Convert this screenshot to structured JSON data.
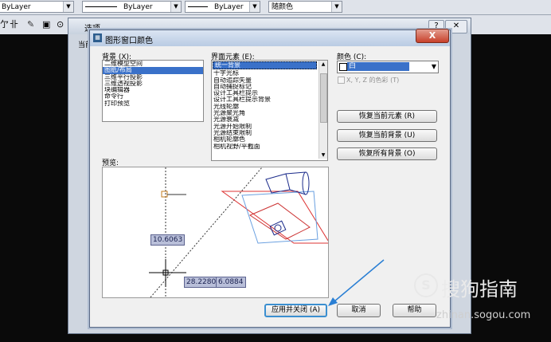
{
  "toolbar": {
    "layer_combo": "ByLayer",
    "linetype_combo": "ByLayer",
    "lineweight_combo": "ByLayer",
    "color_combo": "随颜色",
    "dialog_title": "选项",
    "current_label": "当前"
  },
  "dialog": {
    "title": "图形窗口颜色",
    "close_glyph": "X",
    "help_glyph": "?",
    "background_label": "背景 (X):",
    "background_items": [
      "二维模型空间",
      "图纸/布局",
      "三维平行投影",
      "三维透视投影",
      "块编辑器",
      "命令行",
      "打印预览"
    ],
    "background_selected": 1,
    "element_label": "界面元素 (E):",
    "element_items": [
      "统一背景",
      "十字光标",
      "自动追踪矢量",
      "自动捕捉标记",
      "设计工具栏提示",
      "设计工具栏提示背景",
      "光线轮廓",
      "光源聚光角",
      "光源衰减",
      "光源开始限制",
      "光源结束限制",
      "相机轮廓色",
      "相机视野/平截面"
    ],
    "element_selected": 0,
    "color_label": "颜色 (C):",
    "color_value": "白",
    "xyz_checkbox_label": "X, Y, Z 的色彩 (T)",
    "restore_element": "恢复当前元素 (R)",
    "restore_background": "恢复当前背景 (U)",
    "restore_all": "恢复所有背景 (O)",
    "preview_label": "预览:",
    "preview_values": {
      "v1": "10.6063",
      "v2": "28.2280",
      "v3": "6.0884"
    },
    "apply_close": "应用并关闭 (A)",
    "cancel": "取消",
    "help": "帮助"
  },
  "watermark": {
    "text": "搜狗指南",
    "url": "zhinan.sogou.com"
  },
  "colors": {
    "selection": "#3a71c9",
    "accent_arrow": "#2a7fd4",
    "default_border": "#3b8fd0"
  }
}
